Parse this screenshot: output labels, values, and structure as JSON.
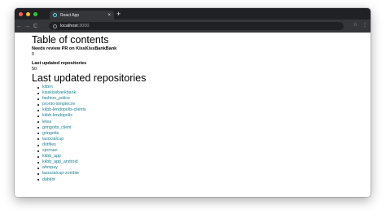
{
  "browser": {
    "tab_title": "React App",
    "tab_close": "×",
    "new_tab": "+",
    "url_host": "localhost",
    "url_port": ":3000",
    "back": "←",
    "forward": "→",
    "reload": "C",
    "star": "☆",
    "menu": "⋮"
  },
  "content": {
    "toc_heading": "Table of contents",
    "needs_review_label": "Needs review PR on KissKissBankBank",
    "needs_review_value": "0",
    "last_updated_label": "Last updated repositories",
    "last_updated_value": "50",
    "repos_heading": "Last updated repositories",
    "repos": [
      "kitten",
      "kisskissbankbank",
      "fashion_police",
      "pronto-simplecov",
      "kkbb-lendopolis-clients",
      "kkbb-lendopolis",
      "lelea",
      "gringotts_client",
      "gringotts",
      "lasocialcup",
      "dotfiles",
      "spcman",
      "kkbb_app",
      "kkbb_app_android",
      "ahmpay",
      "lasocialcup-zombie",
      "dabitor"
    ]
  }
}
